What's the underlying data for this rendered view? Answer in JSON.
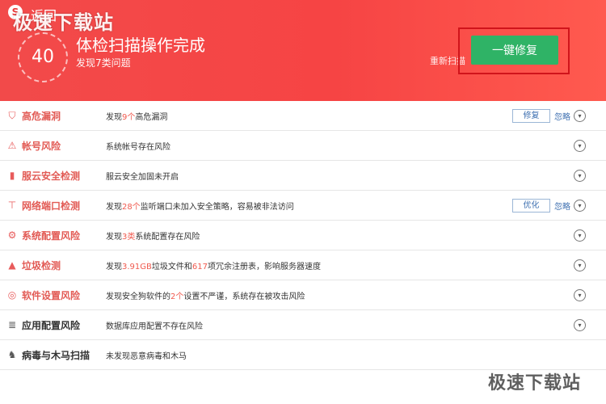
{
  "header": {
    "back_label": "返回",
    "watermark": "极速下载站",
    "score": "40",
    "title": "体检扫描操作完成",
    "subtitle": "发现7类问题",
    "rescan_label": "重新扫描",
    "fix_all_label": "一键修复",
    "accent_color": "#2fb366",
    "brand_color": "#f24a4a"
  },
  "items": [
    {
      "name": "高危漏洞",
      "icon": "shield-icon",
      "desc": [
        "发现",
        "9个",
        "高危漏洞"
      ],
      "action": "修复",
      "ignore": "忽略"
    },
    {
      "name": "帐号风险",
      "icon": "shield-warning-icon",
      "desc": [
        "系统帐号存在风险"
      ]
    },
    {
      "name": "服云安全检测",
      "icon": "bars-icon",
      "desc": [
        "服云安全加固未开启"
      ]
    },
    {
      "name": "网络端口检测",
      "icon": "network-icon",
      "desc": [
        "发现",
        "28个",
        "监听端口未加入安全策略，容易被非法访问"
      ],
      "action": "优化",
      "ignore": "忽略"
    },
    {
      "name": "系统配置风险",
      "icon": "system-config-icon",
      "desc": [
        "发现",
        "3类",
        "系统配置存在风险"
      ]
    },
    {
      "name": "垃圾检测",
      "icon": "broom-icon",
      "desc": [
        "发现",
        "3.91GB",
        "垃圾文件和",
        "617",
        "项冗余注册表，影响服务器速度"
      ]
    },
    {
      "name": "软件设置风险",
      "icon": "target-icon",
      "desc": [
        "发现安全狗软件的",
        "2个",
        "设置不严谨，系统存在被攻击风险"
      ]
    },
    {
      "name": "应用配置风险",
      "icon": "database-icon",
      "desc": [
        "数据库应用配置不存在风险"
      ]
    },
    {
      "name": "病毒与木马扫描",
      "icon": "horse-icon",
      "desc": [
        "未发现恶意病毒和木马"
      ]
    }
  ],
  "footer_watermark": "极速下载站"
}
